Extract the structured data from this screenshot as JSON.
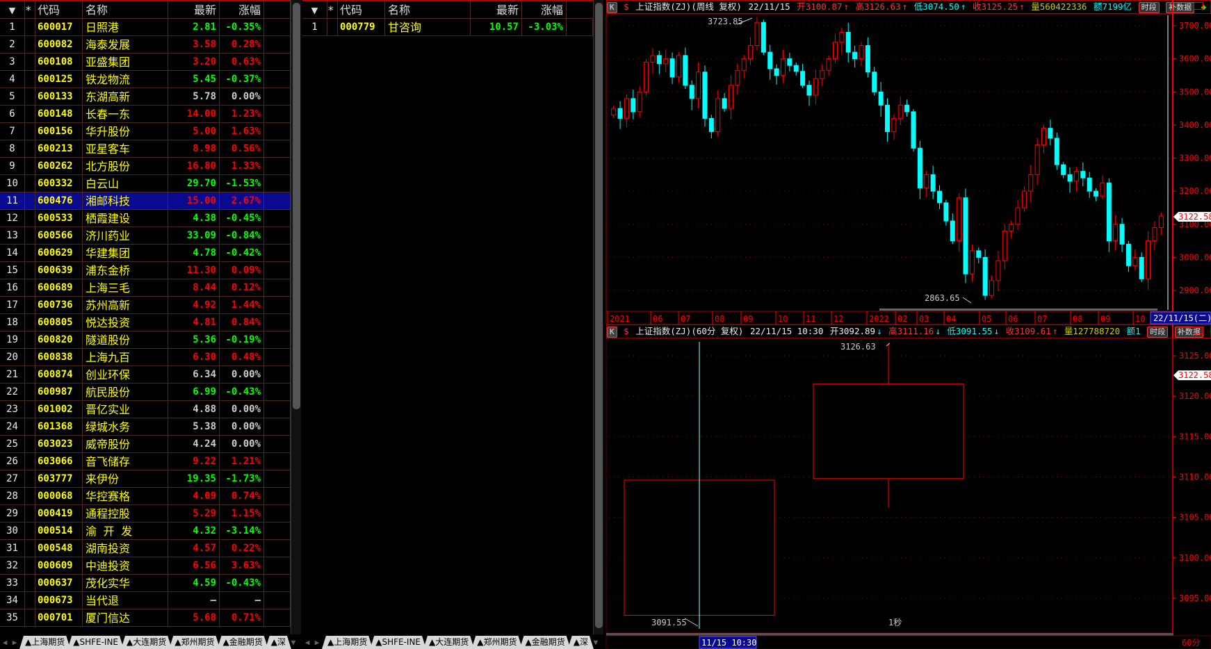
{
  "headers": {
    "sort": "▼",
    "star": "*",
    "code": "代码",
    "name": "名称",
    "price": "最新",
    "pct": "涨幅"
  },
  "left_rows": [
    [
      "1",
      "600017",
      "日照港",
      "2.81",
      "-0.35%"
    ],
    [
      "2",
      "600082",
      "海泰发展",
      "3.58",
      "0.28%"
    ],
    [
      "3",
      "600108",
      "亚盛集团",
      "3.20",
      "0.63%"
    ],
    [
      "4",
      "600125",
      "铁龙物流",
      "5.45",
      "-0.37%"
    ],
    [
      "5",
      "600133",
      "东湖高新",
      "5.78",
      "0.00%"
    ],
    [
      "6",
      "600148",
      "长春一东",
      "14.00",
      "1.23%"
    ],
    [
      "7",
      "600156",
      "华升股份",
      "5.00",
      "1.63%"
    ],
    [
      "8",
      "600213",
      "亚星客车",
      "8.98",
      "0.56%"
    ],
    [
      "9",
      "600262",
      "北方股份",
      "16.80",
      "1.33%"
    ],
    [
      "10",
      "600332",
      "白云山",
      "29.70",
      "-1.53%"
    ],
    [
      "11",
      "600476",
      "湘邮科技",
      "15.00",
      "2.67%"
    ],
    [
      "12",
      "600533",
      "栖霞建设",
      "4.38",
      "-0.45%"
    ],
    [
      "13",
      "600566",
      "济川药业",
      "33.09",
      "-0.84%"
    ],
    [
      "14",
      "600629",
      "华建集团",
      "4.78",
      "-0.42%"
    ],
    [
      "15",
      "600639",
      "浦东金桥",
      "11.30",
      "0.09%"
    ],
    [
      "16",
      "600689",
      "上海三毛",
      "8.44",
      "0.12%"
    ],
    [
      "17",
      "600736",
      "苏州高新",
      "4.92",
      "1.44%"
    ],
    [
      "18",
      "600805",
      "悦达投资",
      "4.81",
      "0.84%"
    ],
    [
      "19",
      "600820",
      "隧道股份",
      "5.36",
      "-0.19%"
    ],
    [
      "20",
      "600838",
      "上海九百",
      "6.30",
      "0.48%"
    ],
    [
      "21",
      "600874",
      "创业环保",
      "6.34",
      "0.00%"
    ],
    [
      "22",
      "600987",
      "航民股份",
      "6.99",
      "-0.43%"
    ],
    [
      "23",
      "601002",
      "晋亿实业",
      "4.88",
      "0.00%"
    ],
    [
      "24",
      "601368",
      "绿城水务",
      "5.38",
      "0.00%"
    ],
    [
      "25",
      "603023",
      "威帝股份",
      "4.24",
      "0.00%"
    ],
    [
      "26",
      "603066",
      "音飞储存",
      "9.22",
      "1.21%"
    ],
    [
      "27",
      "603777",
      "来伊份",
      "19.35",
      "-1.73%"
    ],
    [
      "28",
      "000068",
      "华控赛格",
      "4.09",
      "0.74%"
    ],
    [
      "29",
      "000419",
      "通程控股",
      "5.29",
      "1.15%"
    ],
    [
      "30",
      "000514",
      "渝 开 发",
      "4.32",
      "-3.14%"
    ],
    [
      "31",
      "000548",
      "湖南投资",
      "4.57",
      "0.22%"
    ],
    [
      "32",
      "000609",
      "中迪投资",
      "6.56",
      "3.63%"
    ],
    [
      "33",
      "000637",
      "茂化实华",
      "4.59",
      "-0.43%"
    ],
    [
      "34",
      "000673",
      "当代退",
      "—",
      "—"
    ],
    [
      "35",
      "000701",
      "厦门信达",
      "5.68",
      "0.71%"
    ]
  ],
  "selected_row": 11,
  "mid_rows": [
    [
      "1",
      "000779",
      "甘咨询",
      "10.57",
      "-3.03%"
    ]
  ],
  "tabs": [
    "▲上海期货",
    "▲SHFE-INE",
    "▲大连期货",
    "▲郑州期货",
    "▲金融期货",
    "▲深"
  ],
  "weekly": {
    "k": "K",
    "flag": "$",
    "title": "上证指数(ZJ)(周线 复权)",
    "date": "22/11/15",
    "open": "开3100.87",
    "high": "高3126.63",
    "low": "低3074.50",
    "close": "收3125.25",
    "vol": "量560422336",
    "amt": "额7199亿",
    "btn1": "时段",
    "btn2": "补数据",
    "y_ticks": [
      "3700.00",
      "3600.00",
      "3500.00",
      "3400.00",
      "3300.00",
      "3200.00",
      "3100.00",
      "3000.00",
      "2900.00"
    ],
    "y_tick_values": [
      3700,
      3600,
      3500,
      3400,
      3300,
      3200,
      3100,
      3000,
      2900
    ],
    "current_price": "3122.58",
    "max_label": "3723.85",
    "min_label": "2863.65",
    "x_labels": [
      "2021",
      "06",
      "07",
      "08",
      "09",
      "10",
      "11",
      "12",
      "2022",
      "02",
      "03",
      "04",
      "05",
      "06",
      "07",
      "08",
      "09",
      "10"
    ],
    "cursor_date": "22/11/15(二)",
    "closes": [
      3450,
      3420,
      3480,
      3440,
      3500,
      3590,
      3610,
      3585,
      3600,
      3545,
      3610,
      3520,
      3480,
      3560,
      3420,
      3380,
      3480,
      3450,
      3520,
      3565,
      3600,
      3640,
      3710,
      3620,
      3570,
      3550,
      3600,
      3580,
      3562,
      3520,
      3490,
      3540,
      3565,
      3600,
      3650,
      3680,
      3620,
      3600,
      3640,
      3560,
      3500,
      3460,
      3380,
      3420,
      3460,
      3440,
      3330,
      3210,
      3250,
      3200,
      3165,
      3110,
      3050,
      3180,
      2950,
      3020,
      3000,
      2885,
      2930,
      2990,
      3080,
      3100,
      3150,
      3200,
      3250,
      3340,
      3390,
      3360,
      3280,
      3250,
      3230,
      3260,
      3240,
      3200,
      3185,
      3225,
      3050,
      3100,
      3040,
      2975,
      3000,
      2935,
      3050,
      3090,
      3125
    ]
  },
  "hourly": {
    "k": "K",
    "flag": "$",
    "title": "上证指数(ZJ)(60分 复权)",
    "date": "22/11/15 10:30",
    "open": "开3092.89",
    "high": "高3111.16",
    "low": "低3091.55",
    "close": "收3109.61",
    "vol": "量127788720",
    "amt": "额1",
    "btn1": "时段",
    "btn2": "补数据",
    "y_ticks": [
      "3125.00",
      "3120.00",
      "3115.00",
      "3110.00",
      "3105.00",
      "3100.00",
      "3095.00"
    ],
    "y_tick_values": [
      3125,
      3120,
      3115,
      3110,
      3105,
      3100,
      3095
    ],
    "current_price": "3122.58",
    "candles": [
      {
        "o": 3092.89,
        "h": 3111.16,
        "l": 3091.55,
        "c": 3109.61
      },
      {
        "o": 3109.8,
        "h": 3126.63,
        "l": 3106.2,
        "c": 3121.5
      }
    ],
    "max_label": "3126.63",
    "min_label": "3091.55",
    "mid_label": "1秒",
    "cursor_time": "11/15 10:30",
    "period": "60分"
  },
  "colors": {
    "up": "#ff0000",
    "down": "#00ffff",
    "axis": "#ff0000",
    "bg": "#000000"
  }
}
